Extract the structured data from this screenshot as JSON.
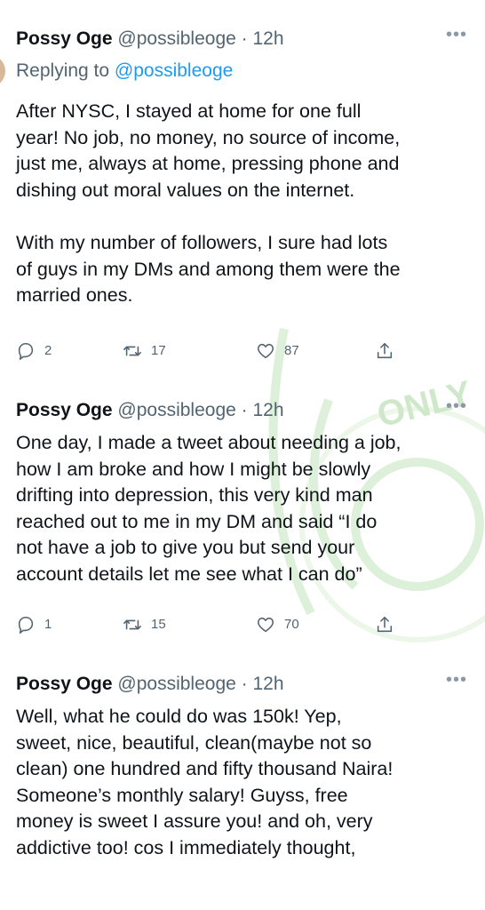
{
  "tweets": [
    {
      "name": "Possy Oge",
      "handle": "@possibleoge",
      "separator": "·",
      "time": "12h",
      "replying_label": "Replying to",
      "replying_handle": "@possibleoge",
      "body": "After NYSC, I stayed at home for one full\nyear! No job, no money, no source of income,\njust me, always at home, pressing phone and\ndishing out moral values on the internet.\n\nWith my number of followers, I sure had lots\nof guys in my DMs and among them were the\nmarried ones.",
      "replies": "2",
      "retweets": "17",
      "likes": "87"
    },
    {
      "name": "Possy Oge",
      "handle": "@possibleoge",
      "separator": "·",
      "time": "12h",
      "body": "One day, I made a tweet about needing a job,\nhow I am broke and how I might be slowly\ndrifting into depression, this very kind man\nreached out to me in my DM and said “I do\nnot have a job to give you but send your\naccount details let me see what I can do”",
      "replies": "1",
      "retweets": "15",
      "likes": "70"
    },
    {
      "name": "Possy Oge",
      "handle": "@possibleoge",
      "separator": "·",
      "time": "12h",
      "body": "Well, what he could do was 150k! Yep,\nsweet, nice, beautiful, clean(maybe not so\nclean) one hundred and fifty thousand Naira!\nSomeone’s monthly salary! Guyss, free\nmoney is sweet I assure you! and oh, very\naddictive too! cos I immediately thought,"
    }
  ],
  "watermark": {
    "text": "ONLY",
    "color": "#cfe8c9"
  },
  "colors": {
    "link": "#1d9bf0",
    "secondary": "#536471",
    "text": "#0f1419"
  },
  "icons": [
    "reply-icon",
    "retweet-icon",
    "like-icon",
    "share-icon",
    "more-options-icon"
  ]
}
